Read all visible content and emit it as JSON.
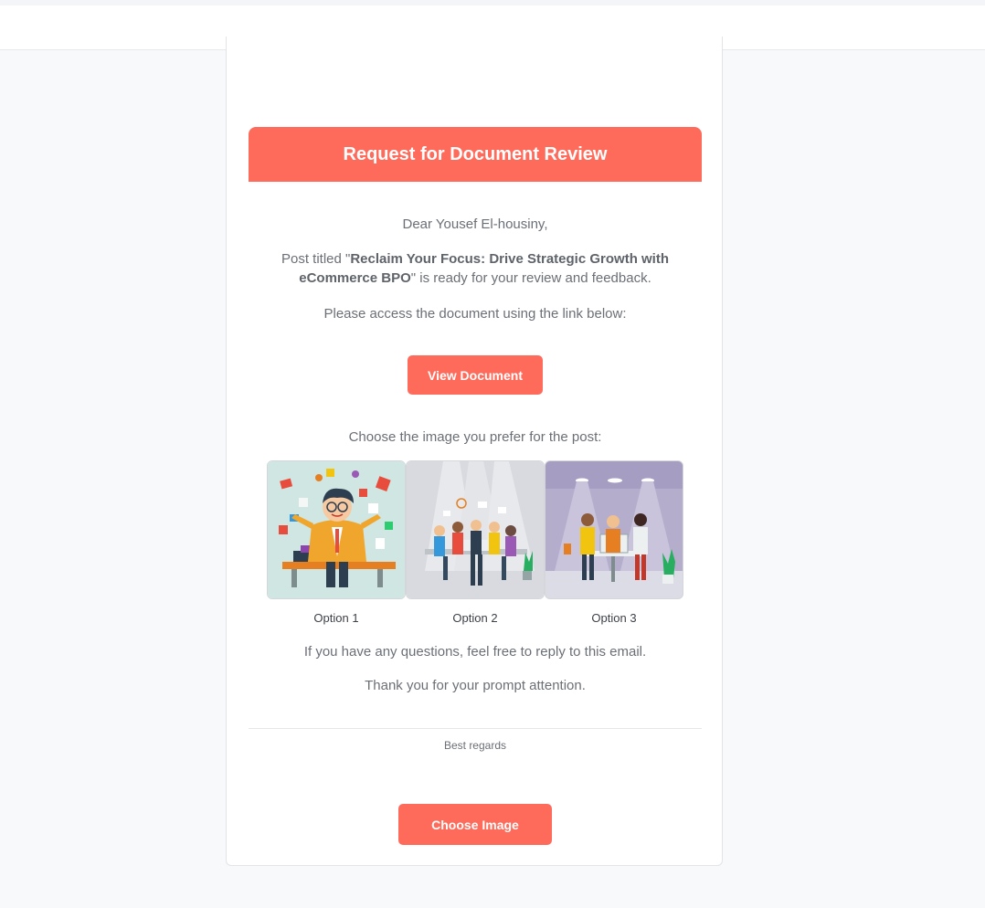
{
  "email": {
    "title": "Request for Document Review",
    "greeting": "Dear Yousef El-housiny,",
    "post_prefix": "Post titled \"",
    "post_title": "Reclaim Your Focus: Drive Strategic Growth with eCommerce BPO",
    "post_suffix": "\" is ready for your review and feedback.",
    "access_text": "Please access the document using the link below:",
    "view_button": "View Document",
    "choose_prompt": "Choose the image you prefer for the post:",
    "options": [
      {
        "label": "Option 1"
      },
      {
        "label": "Option 2"
      },
      {
        "label": "Option 3"
      }
    ],
    "questions_text": "If you have any questions, feel free to reply to this email.",
    "thanks_text": "Thank you for your prompt attention.",
    "regards": "Best regards",
    "choose_button": "Choose Image"
  },
  "colors": {
    "accent": "#ff6b5b",
    "page_bg": "#f8f9fb",
    "text": "#6b6f76"
  }
}
